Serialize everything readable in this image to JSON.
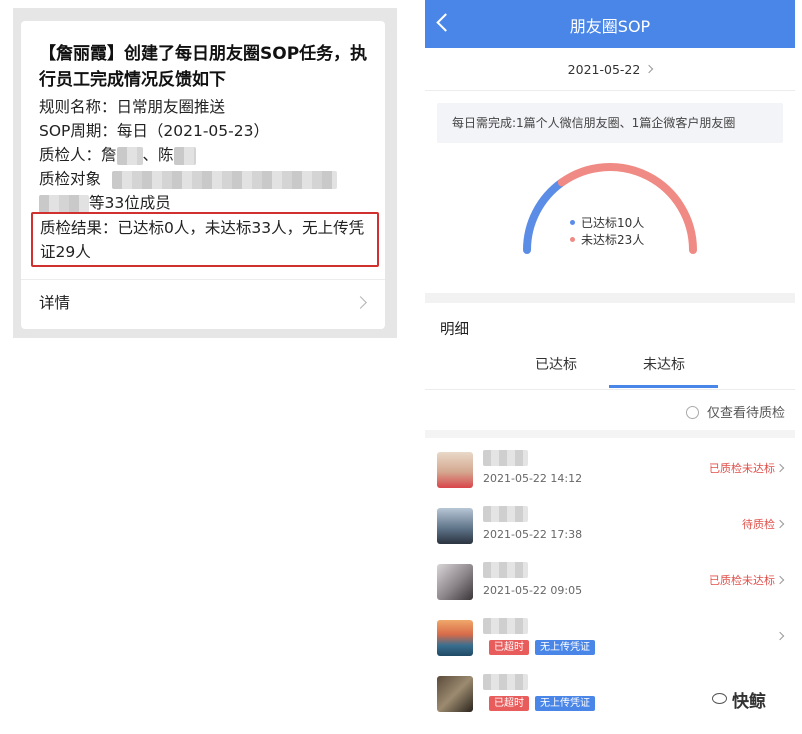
{
  "message": {
    "title": "【詹丽霞】创建了每日朋友圈SOP任务，执行员工完成情况反馈如下",
    "rule_name": "规则名称：日常朋友圈推送",
    "sop_period": "SOP周期：每日（2021-05-23）",
    "inspector_prefix": "质检人：詹",
    "inspector_mid": "、陈",
    "target_prefix": "质检对象",
    "target_suffix": "等33位成员",
    "result": "质检结果：已达标0人，未达标33人，无上传凭证29人",
    "detail": "详情"
  },
  "sop": {
    "nav_title": "朋友圈SOP",
    "date": "2021-05-22",
    "requirement": "每日需完成:1篇个人微信朋友圈、1篇企微客户朋友圈",
    "gauge_legend": [
      {
        "label": "已达标10人",
        "value": 10,
        "color": "#5b8de6"
      },
      {
        "label": "未达标23人",
        "value": 23,
        "color": "#f08a84"
      }
    ],
    "section_title": "明细",
    "tabs": [
      "已达标",
      "未达标"
    ],
    "active_tab": "未达标",
    "filter_label": "仅查看待质检",
    "rows": [
      {
        "time": "2021-05-22 14:12",
        "status": "已质检未达标",
        "status_color": "#e0504a"
      },
      {
        "time": "2021-05-22 17:38",
        "status": "待质检",
        "status_color": "#e0504a"
      },
      {
        "time": "2021-05-22 09:05",
        "status": "已质检未达标",
        "status_color": "#e0504a"
      },
      {
        "badges": [
          "已超时",
          "无上传凭证"
        ]
      },
      {
        "badges": [
          "已超时",
          "无上传凭证"
        ]
      }
    ]
  },
  "brand": {
    "text": "快鲸"
  }
}
